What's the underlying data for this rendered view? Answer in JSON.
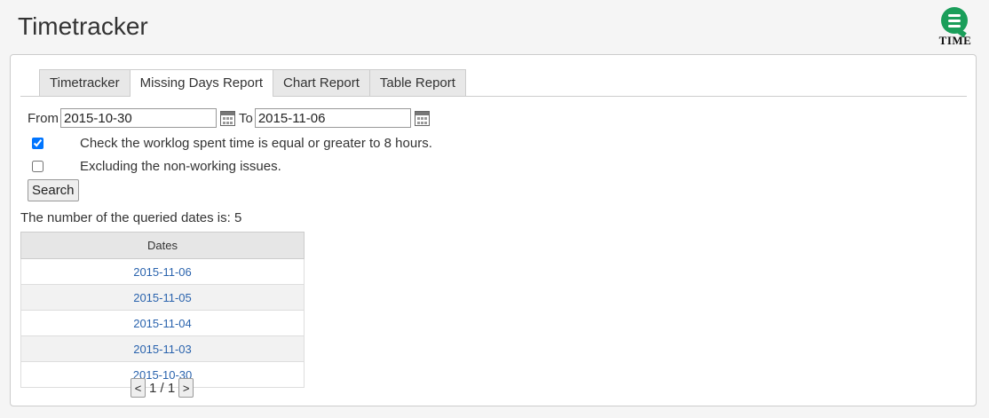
{
  "header": {
    "title": "Timetracker",
    "logo_text": "TIME"
  },
  "tabs": [
    {
      "label": "Timetracker",
      "active": false
    },
    {
      "label": "Missing Days Report",
      "active": true
    },
    {
      "label": "Chart Report",
      "active": false
    },
    {
      "label": "Table Report",
      "active": false
    }
  ],
  "filters": {
    "from_label": "From",
    "from_value": "2015-10-30",
    "to_label": "To",
    "to_value": "2015-11-06",
    "check_worklog": {
      "label": "Check the worklog spent time is equal or greater to 8 hours.",
      "checked": true
    },
    "exclude_nonworking": {
      "label": "Excluding the non-working issues.",
      "checked": false
    },
    "search_label": "Search"
  },
  "results": {
    "count_text": "The number of the queried dates is: 5",
    "column_header": "Dates",
    "dates": [
      "2015-11-06",
      "2015-11-05",
      "2015-11-04",
      "2015-11-03",
      "2015-10-30"
    ]
  },
  "pager": {
    "prev_label": "<",
    "page_text": "1 / 1",
    "next_label": ">"
  },
  "colors": {
    "accent": "#1a9e5a",
    "link": "#2a63ad"
  }
}
